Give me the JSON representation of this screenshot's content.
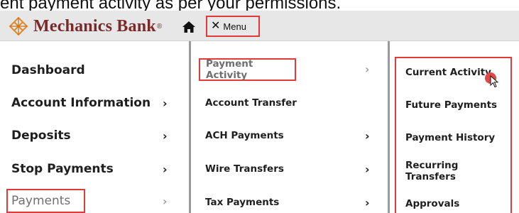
{
  "caption": "ent payment activity as per your permissions.",
  "header": {
    "brand": "Mechanics Bank",
    "brand_mark": "®",
    "menu_label": "Menu"
  },
  "icons": {
    "logo": "diamond-lattice-logo",
    "home": "home-icon",
    "close": "close-icon",
    "chevron": "chevron-right-icon",
    "cursor": "mouse-pointer-icon"
  },
  "colors": {
    "brand": "#7a2a2a",
    "highlight": "#e03b3b",
    "header_bg": "#e7e7e7"
  },
  "col1": [
    {
      "label": "Dashboard",
      "chevron": ""
    },
    {
      "label": "Account Information",
      "chevron": "›"
    },
    {
      "label": "Deposits",
      "chevron": "›"
    },
    {
      "label": "Stop Payments",
      "chevron": "›"
    },
    {
      "label": "Payments",
      "chevron": "›"
    }
  ],
  "col2": [
    {
      "label": "Payment Activity",
      "chevron": "›"
    },
    {
      "label": "Account Transfer",
      "chevron": ""
    },
    {
      "label": "ACH Payments",
      "chevron": "›"
    },
    {
      "label": "Wire Transfers",
      "chevron": "›"
    },
    {
      "label": "Tax Payments",
      "chevron": "›"
    }
  ],
  "col3": [
    {
      "label": "Current Activity"
    },
    {
      "label": "Future Payments"
    },
    {
      "label": "Payment History"
    },
    {
      "label": "Recurring Transfers"
    },
    {
      "label": "Approvals"
    }
  ]
}
